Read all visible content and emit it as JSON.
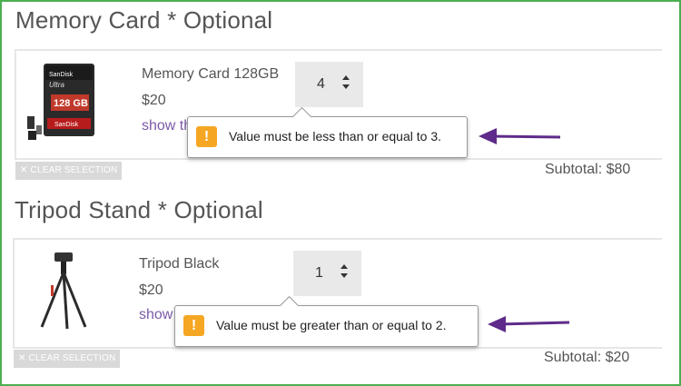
{
  "sections": [
    {
      "title": "Memory Card * Optional",
      "product": {
        "name": "Memory Card 128GB",
        "price": "$20",
        "link": "show th",
        "image_text": {
          "brand": "SanDisk",
          "line": "Ultra",
          "capacity": "128 GB"
        }
      },
      "quantity": "4",
      "tooltip": "Value must be less than or equal to 3.",
      "clear_label": "✕ CLEAR SELECTION",
      "subtotal": "Subtotal: $80"
    },
    {
      "title": "Tripod Stand * Optional",
      "product": {
        "name": "Tripod Black",
        "price": "$20",
        "link": "show"
      },
      "quantity": "1",
      "tooltip": "Value must be greater than or equal to 2.",
      "clear_label": "✕ CLEAR SELECTION",
      "subtotal": "Subtotal: $20"
    }
  ],
  "icons": {
    "warning": "warning-icon",
    "arrow": "purple-arrow-icon",
    "spin_up": "spin-up-icon",
    "spin_down": "spin-down-icon"
  },
  "colors": {
    "frame": "#4caf50",
    "arrow": "#5e2b8a",
    "warning": "#f5a623",
    "link": "#7b5aa6"
  }
}
